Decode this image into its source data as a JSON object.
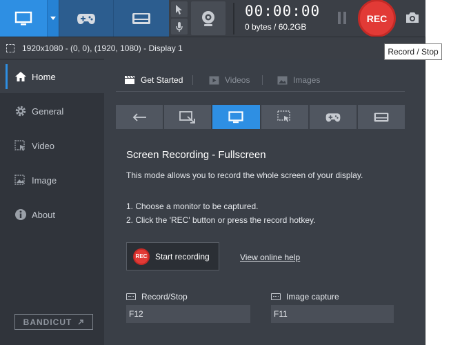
{
  "toolbar": {
    "timer": "00:00:00",
    "size": "0 bytes / 60.2GB",
    "rec_label": "REC",
    "mode_icons": [
      "monitor-icon",
      "chevron-down-icon",
      "gamepad-icon",
      "hdmi-icon"
    ],
    "tooltip": "Record / Stop"
  },
  "infobar": {
    "text": "1920x1080 - (0, 0), (1920, 1080) - Display 1"
  },
  "sidebar": {
    "items": [
      {
        "label": "Home",
        "icon": "home-icon"
      },
      {
        "label": "General",
        "icon": "gear-icon"
      },
      {
        "label": "Video",
        "icon": "video-icon"
      },
      {
        "label": "Image",
        "icon": "image-icon"
      },
      {
        "label": "About",
        "icon": "info-icon"
      }
    ],
    "bandicut": "BANDICUT"
  },
  "main": {
    "tabs": [
      {
        "label": "Get Started",
        "icon": "clapper-icon"
      },
      {
        "label": "Videos",
        "icon": "play-icon"
      },
      {
        "label": "Images",
        "icon": "picture-icon"
      }
    ],
    "title": "Screen Recording - Fullscreen",
    "description": "This mode allows you to record the whole screen of your display.",
    "step1": "1. Choose a monitor to be captured.",
    "step2": "2. Click the 'REC' button or press the record hotkey.",
    "start_mini_rec": "REC",
    "start_label": "Start recording",
    "help_link": "View online help",
    "hotkeys": [
      {
        "label": "Record/Stop",
        "value": "F12"
      },
      {
        "label": "Image capture",
        "value": "F11"
      }
    ]
  },
  "colors": {
    "accent": "#2e8fe3",
    "rec": "#e23a36",
    "panel": "#3a3f47",
    "sidebar": "#30343b"
  }
}
